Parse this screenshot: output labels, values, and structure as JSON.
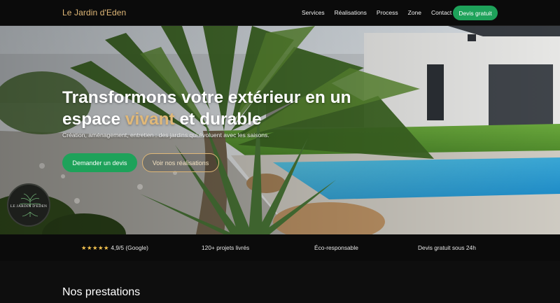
{
  "nav": {
    "brand": "Le Jardin d'Eden",
    "links": [
      "Services",
      "Réalisations",
      "Process",
      "Zone",
      "Contact"
    ],
    "cta": "Devis gratuit"
  },
  "hero": {
    "title_part1": "Transformons votre extérieur en un espace ",
    "title_accent": "vivant",
    "title_part2": " et durable",
    "subtitle": "Création, aménagement, entretien : des jardins qui évoluent avec les saisons.",
    "primary_button": "Demander un devis",
    "secondary_button": "Voir nos réalisations",
    "badge_text": "LE JARDIN D'EDEN"
  },
  "trust": {
    "stars": "★★★★★",
    "rating": "4,9/5 (Google)",
    "projects": "120+ projets livrés",
    "eco": "Éco-responsable",
    "quote": "Devis gratuit sous 24h"
  },
  "section": {
    "title": "Nos prestations"
  },
  "colors": {
    "accent": "#e0b878",
    "green": "#1ea25a",
    "background": "#0b0b0b"
  }
}
